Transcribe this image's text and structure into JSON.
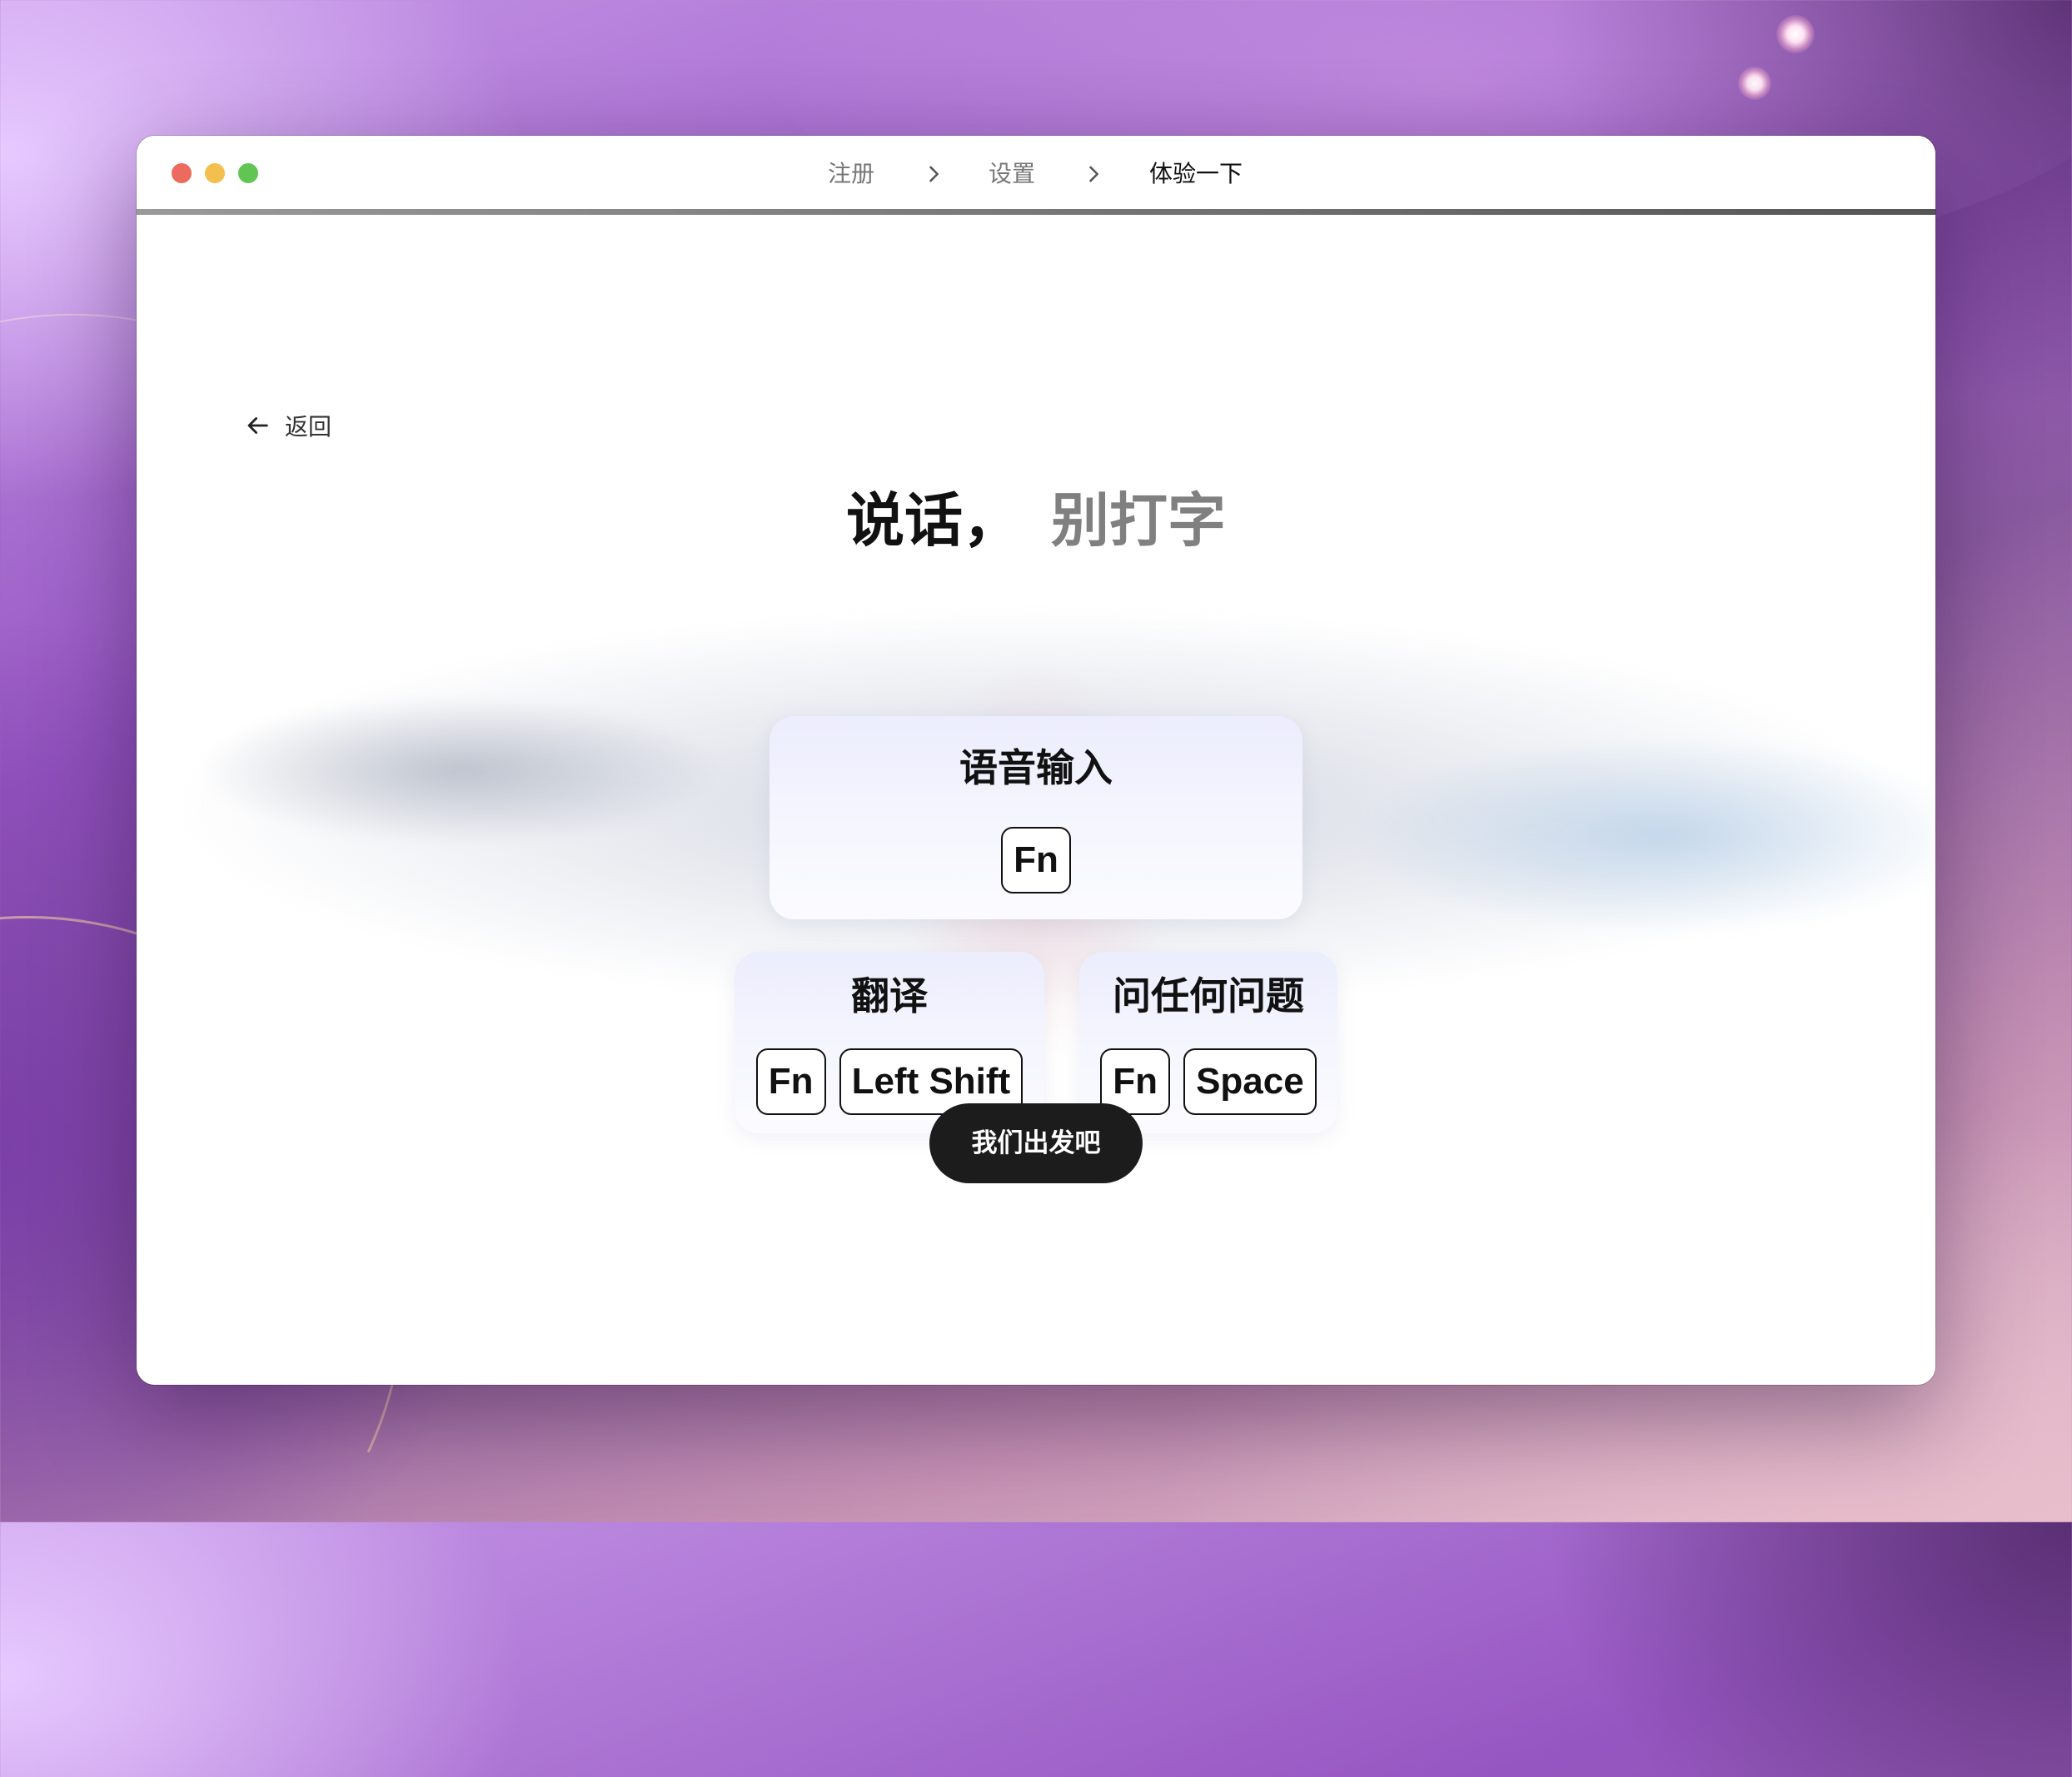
{
  "window": {
    "steps": [
      {
        "label": "注册",
        "state": "done"
      },
      {
        "label": "设置",
        "state": "done"
      },
      {
        "label": "体验一下",
        "state": "current"
      }
    ],
    "progress": 1.0
  },
  "nav": {
    "back_label": "返回",
    "back_icon": "arrow-left-icon"
  },
  "headline": {
    "strong": "说话，",
    "muted": "别打字"
  },
  "shortcuts": [
    {
      "title": "语音输入",
      "keys": [
        "Fn"
      ]
    },
    {
      "title": "翻译",
      "keys": [
        "Fn",
        "Left Shift"
      ]
    },
    {
      "title": "问任何问题",
      "keys": [
        "Fn",
        "Space"
      ]
    }
  ],
  "cta": {
    "label": "我们出发吧"
  },
  "colors": {
    "close": "#ec6a5e",
    "minimize": "#f4bf4f",
    "maximize": "#61c554",
    "cta_background": "#1c1c1c",
    "card_gradient_top": "#ecedfd"
  }
}
